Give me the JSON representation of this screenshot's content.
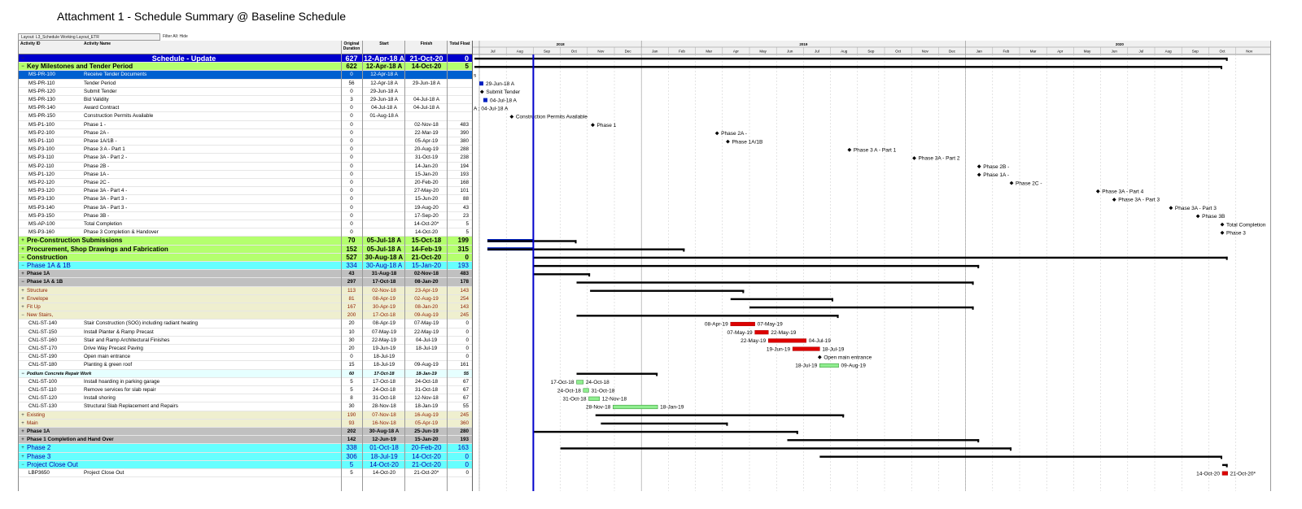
{
  "title": "Attachment 1 - Schedule Summary @ Baseline Schedule",
  "layout_label": "Layout: L3_Schedule Working Layout_ETR",
  "filter_label": "Filter All: Hide",
  "headers": {
    "id": "Activity ID",
    "name": "Activity Name",
    "dur": "Original Duration",
    "start": "Start",
    "finish": "Finish",
    "tf": "Total Float"
  },
  "timeline": {
    "years": [
      {
        "label": "2018",
        "from": 0,
        "to": 6
      },
      {
        "label": "2019",
        "from": 6,
        "to": 18
      },
      {
        "label": "2020",
        "from": 18,
        "to": 30
      }
    ],
    "months": [
      "Jul",
      "Aug",
      "Sep",
      "Oct",
      "Nov",
      "Dec",
      "Jan",
      "Feb",
      "Mar",
      "Apr",
      "May",
      "Jun",
      "Jul",
      "Aug",
      "Sep",
      "Oct",
      "Nov",
      "Dec",
      "Jan",
      "Feb",
      "Mar",
      "Apr",
      "May",
      "Jun",
      "Jul",
      "Aug",
      "Sep",
      "Oct",
      "Nov"
    ],
    "data_date_month": 2.0
  },
  "rows": [
    {
      "style": "grp-root",
      "exp": "−",
      "title": "Schedule - Update",
      "dur": "627",
      "start": "12-Apr-18 A",
      "finish": "21-Oct-20",
      "tf": "0",
      "bar": {
        "type": "summary",
        "s": -2,
        "e": 27.7
      }
    },
    {
      "style": "grp-green",
      "exp": "−",
      "title": "Key Milestones and Tender Period",
      "dur": "622",
      "start": "12-Apr-18 A",
      "finish": "14-Oct-20",
      "tf": "5",
      "bar": {
        "type": "summary",
        "s": -2,
        "e": 27.5
      }
    },
    {
      "style": "sel",
      "id": "MS-PR-100",
      "name": "Receive Tender Documents",
      "dur": "0",
      "start": "12-Apr-18 A",
      "finish": "",
      "tf": "",
      "bar": {
        "type": "text",
        "x": 0,
        "label": "s",
        "anchor": "start"
      }
    },
    {
      "style": "act",
      "id": "MS-PR-110",
      "name": "Tender Period",
      "dur": "56",
      "start": "12-Apr-18 A",
      "finish": "29-Jun-18 A",
      "tf": "",
      "bar": {
        "type": "done",
        "x": 0,
        "label": "29-Jun-18 A"
      }
    },
    {
      "style": "act",
      "id": "MS-PR-120",
      "name": "Submit Tender",
      "dur": "0",
      "start": "29-Jun-18 A",
      "finish": "",
      "tf": "",
      "bar": {
        "type": "ms",
        "x": 0.1,
        "label": "Submit Tender"
      }
    },
    {
      "style": "act",
      "id": "MS-PR-130",
      "name": "Bid Validity",
      "dur": "3",
      "start": "29-Jun-18 A",
      "finish": "04-Jul-18 A",
      "tf": "",
      "bar": {
        "type": "done",
        "x": 0.15,
        "label": "04-Jul-18 A"
      }
    },
    {
      "style": "act",
      "id": "MS-PR-140",
      "name": "Award Contract",
      "dur": "0",
      "start": "04-Jul-18 A",
      "finish": "04-Jul-18 A",
      "tf": "",
      "bar": {
        "type": "text",
        "x": 0,
        "label": "A  ;  04-Jul-18 A",
        "anchor": "start"
      }
    },
    {
      "style": "act",
      "id": "MS-PR-150",
      "name": "Construction Permits Available",
      "dur": "0",
      "start": "01-Aug-18 A",
      "finish": "",
      "tf": "",
      "bar": {
        "type": "ms",
        "x": 1.2,
        "label": "Construction Permits Available"
      }
    },
    {
      "style": "act",
      "id": "MS-P1-100",
      "name": "Phase 1 -",
      "dur": "0",
      "start": "",
      "finish": "02-Nov-18",
      "tf": "483",
      "bar": {
        "type": "ms",
        "x": 4.2,
        "label": "Phase 1"
      }
    },
    {
      "style": "act",
      "id": "MS-P2-100",
      "name": "Phase 2A -",
      "dur": "0",
      "start": "",
      "finish": "22-Mar-19",
      "tf": "390",
      "bar": {
        "type": "ms",
        "x": 8.8,
        "label": "Phase 2A -"
      }
    },
    {
      "style": "act",
      "id": "MS-P1-110",
      "name": "Phase 1A/1B -",
      "dur": "0",
      "start": "",
      "finish": "05-Apr-19",
      "tf": "380",
      "bar": {
        "type": "ms",
        "x": 9.2,
        "label": "Phase 1A/1B"
      }
    },
    {
      "style": "act",
      "id": "MS-P3-100",
      "name": "Phase 3 A - Part 1",
      "dur": "0",
      "start": "",
      "finish": "20-Aug-19",
      "tf": "288",
      "bar": {
        "type": "ms",
        "x": 13.7,
        "label": "Phase 3 A - Part 1"
      }
    },
    {
      "style": "act",
      "id": "MS-P3-110",
      "name": "Phase 3A - Part 2 -",
      "dur": "0",
      "start": "",
      "finish": "31-Oct-19",
      "tf": "238",
      "bar": {
        "type": "ms",
        "x": 16.1,
        "label": "Phase 3A - Part 2"
      }
    },
    {
      "style": "act",
      "id": "MS-P2-110",
      "name": "Phase 2B -",
      "dur": "0",
      "start": "",
      "finish": "14-Jan-20",
      "tf": "194",
      "bar": {
        "type": "ms",
        "x": 18.5,
        "label": "Phase 2B -"
      }
    },
    {
      "style": "act",
      "id": "MS-P1-120",
      "name": "Phase 1A -",
      "dur": "0",
      "start": "",
      "finish": "15-Jan-20",
      "tf": "193",
      "bar": {
        "type": "ms",
        "x": 18.5,
        "label": "Phase 1A -"
      }
    },
    {
      "style": "act",
      "id": "MS-P2-120",
      "name": "Phase 2C -",
      "dur": "0",
      "start": "",
      "finish": "20-Feb-20",
      "tf": "168",
      "bar": {
        "type": "ms",
        "x": 19.7,
        "label": "Phase 2C -"
      }
    },
    {
      "style": "act",
      "id": "MS-P3-120",
      "name": "Phase 3A - Part 4 -",
      "dur": "0",
      "start": "",
      "finish": "27-May-20",
      "tf": "101",
      "bar": {
        "type": "ms",
        "x": 22.9,
        "label": "Phase 3A - Part 4"
      }
    },
    {
      "style": "act",
      "id": "MS-P3-130",
      "name": "Phase 3A - Part 3 -",
      "dur": "0",
      "start": "",
      "finish": "15-Jun-20",
      "tf": "88",
      "bar": {
        "type": "ms",
        "x": 23.5,
        "label": "Phase 3A - Part 3"
      }
    },
    {
      "style": "act",
      "id": "MS-P3-140",
      "name": "Phase 3A - Part 3 -",
      "dur": "0",
      "start": "",
      "finish": "19-Aug-20",
      "tf": "43",
      "bar": {
        "type": "ms",
        "x": 25.6,
        "label": "Phase 3A - Part 3"
      }
    },
    {
      "style": "act",
      "id": "MS-P3-150",
      "name": "Phase 3B -",
      "dur": "0",
      "start": "",
      "finish": "17-Sep-20",
      "tf": "23",
      "bar": {
        "type": "ms",
        "x": 26.6,
        "label": "Phase 3B"
      }
    },
    {
      "style": "act",
      "id": "MS-AP-100",
      "name": "Total Completion",
      "dur": "0",
      "start": "",
      "finish": "14-Oct-20*",
      "tf": "5",
      "bar": {
        "type": "ms",
        "x": 27.5,
        "label": "Total Completion"
      }
    },
    {
      "style": "act",
      "id": "MS-P3-160",
      "name": "Phase 3 Completion & Handover",
      "dur": "0",
      "start": "",
      "finish": "14-Oct-20",
      "tf": "5",
      "bar": {
        "type": "ms",
        "x": 27.5,
        "label": "Phase 3"
      }
    },
    {
      "style": "grp-green",
      "exp": "+",
      "title": "Pre-Construction Submissions",
      "dur": "70",
      "start": "05-Jul-18 A",
      "finish": "15-Oct-18",
      "tf": "199",
      "bar": {
        "type": "summary",
        "s": 0.3,
        "e": 3.6,
        "blue": true
      }
    },
    {
      "style": "grp-green",
      "exp": "+",
      "title": "Procurement, Shop Drawings and Fabrication",
      "dur": "152",
      "start": "05-Jul-18 A",
      "finish": "14-Feb-19",
      "tf": "315",
      "bar": {
        "type": "summary",
        "s": 0.3,
        "e": 7.6,
        "blue": true
      }
    },
    {
      "style": "grp-green",
      "exp": "−",
      "title": "Construction",
      "dur": "527",
      "start": "30-Aug-18 A",
      "finish": "21-Oct-20",
      "tf": "0",
      "bar": {
        "type": "summary",
        "s": 2.0,
        "e": 27.7
      }
    },
    {
      "style": "grp-cyan",
      "exp": "−",
      "title": "Phase 1A & 1B",
      "dur": "334",
      "start": "30-Aug-18 A",
      "finish": "15-Jan-20",
      "tf": "193",
      "bar": {
        "type": "summary",
        "s": 2.0,
        "e": 18.5
      }
    },
    {
      "style": "grp-grey",
      "exp": "+",
      "title": "Phase 1A",
      "dur": "43",
      "start": "31-Aug-18",
      "finish": "02-Nov-18",
      "tf": "483",
      "bar": {
        "type": "summary",
        "s": 2.0,
        "e": 4.1
      }
    },
    {
      "style": "grp-grey",
      "exp": "−",
      "title": "Phase 1A & 1B",
      "dur": "297",
      "start": "17-Oct-18",
      "finish": "08-Jan-20",
      "tf": "178",
      "bar": {
        "type": "summary",
        "s": 3.6,
        "e": 18.3
      }
    },
    {
      "style": "grp-tan",
      "exp": "+",
      "title": "        Structure",
      "dur": "113",
      "start": "02-Nov-18",
      "finish": "23-Apr-19",
      "tf": "143",
      "bar": {
        "type": "summary",
        "s": 4.1,
        "e": 9.8
      }
    },
    {
      "style": "grp-tan",
      "exp": "+",
      "title": "        Envelope",
      "dur": "81",
      "start": "08-Apr-19",
      "finish": "02-Aug-19",
      "tf": "254",
      "bar": {
        "type": "summary",
        "s": 9.3,
        "e": 13.1
      }
    },
    {
      "style": "grp-tan",
      "exp": "+",
      "title": "        Fit Up",
      "dur": "167",
      "start": "30-Apr-19",
      "finish": "08-Jan-20",
      "tf": "143",
      "bar": {
        "type": "summary",
        "s": 10.0,
        "e": 18.3
      }
    },
    {
      "style": "grp-tan",
      "exp": "−",
      "title": "New Stairs,",
      "dur": "200",
      "start": "17-Oct-18",
      "finish": "09-Aug-19",
      "tf": "245",
      "bar": {
        "type": "summary",
        "s": 3.6,
        "e": 13.3
      }
    },
    {
      "style": "act",
      "id": "CN1-ST-140",
      "name": "Stair Construction (SOG) including radiant heating",
      "dur": "20",
      "start": "08-Apr-19",
      "finish": "07-May-19",
      "tf": "0",
      "bar": {
        "type": "crit",
        "s": 9.3,
        "e": 10.2,
        "ls": "08-Apr-19",
        "le": "07-May-19"
      }
    },
    {
      "style": "act",
      "id": "CN1-ST-150",
      "name": "Install Planter & Ramp Precast",
      "dur": "10",
      "start": "07-May-19",
      "finish": "22-May-19",
      "tf": "0",
      "bar": {
        "type": "crit",
        "s": 10.2,
        "e": 10.7,
        "ls": "07-May-19",
        "le": "22-May-19"
      }
    },
    {
      "style": "act",
      "id": "CN1-ST-160",
      "name": "Stair and Ramp Architectural Finishes",
      "dur": "30",
      "start": "22-May-19",
      "finish": "04-Jul-19",
      "tf": "0",
      "bar": {
        "type": "crit",
        "s": 10.7,
        "e": 12.1,
        "ls": "22-May-19",
        "le": "04-Jul-19"
      }
    },
    {
      "style": "act",
      "id": "CN1-ST-170",
      "name": "Drive Way Precast Paving",
      "dur": "20",
      "start": "19-Jun-19",
      "finish": "18-Jul-19",
      "tf": "0",
      "bar": {
        "type": "crit",
        "s": 11.6,
        "e": 12.6,
        "ls": "19-Jun-19",
        "le": "18-Jul-19"
      }
    },
    {
      "style": "act",
      "id": "CN1-ST-190",
      "name": "Open main entrance",
      "dur": "0",
      "start": "18-Jul-19",
      "finish": "",
      "tf": "0",
      "bar": {
        "type": "ms",
        "x": 12.6,
        "label": "Open main entrance"
      }
    },
    {
      "style": "act",
      "id": "CN1-ST-180",
      "name": "Planting & green roof",
      "dur": "15",
      "start": "18-Jul-19",
      "finish": "09-Aug-19",
      "tf": "161",
      "bar": {
        "type": "nc",
        "s": 12.6,
        "e": 13.3,
        "ls": "18-Jul-19",
        "le": "09-Aug-19"
      }
    },
    {
      "style": "grp-ltcyan",
      "exp": "−",
      "title": "Podium Concrete Repair Work",
      "dur": "60",
      "start": "17-Oct-18",
      "finish": "18-Jan-19",
      "tf": "55",
      "bar": {
        "type": "summary",
        "s": 3.6,
        "e": 6.6
      }
    },
    {
      "style": "act",
      "id": "CN1-ST-100",
      "name": "Install hoarding in parking garage",
      "dur": "5",
      "start": "17-Oct-18",
      "finish": "24-Oct-18",
      "tf": "67",
      "bar": {
        "type": "nc",
        "s": 3.6,
        "e": 3.85,
        "ls": "17-Oct-18",
        "le": "24-Oct-18"
      }
    },
    {
      "style": "act",
      "id": "CN1-ST-110",
      "name": "Remove services for slab repair",
      "dur": "5",
      "start": "24-Oct-18",
      "finish": "31-Oct-18",
      "tf": "67",
      "bar": {
        "type": "nc",
        "s": 3.85,
        "e": 4.05,
        "ls": "24-Oct-18",
        "le": "31-Oct-18"
      }
    },
    {
      "style": "act",
      "id": "CN1-ST-120",
      "name": "Install shoring",
      "dur": "8",
      "start": "31-Oct-18",
      "finish": "12-Nov-18",
      "tf": "67",
      "bar": {
        "type": "nc",
        "s": 4.05,
        "e": 4.45,
        "ls": "31-Oct-18",
        "le": "12-Nov-18"
      }
    },
    {
      "style": "act",
      "id": "CN1-ST-130",
      "name": "Structural Slab Replacement and Repairs",
      "dur": "30",
      "start": "28-Nov-18",
      "finish": "18-Jan-19",
      "tf": "55",
      "bar": {
        "type": "nc",
        "s": 4.95,
        "e": 6.6,
        "ls": "28-Nov-18",
        "le": "18-Jan-19"
      }
    },
    {
      "style": "grp-tan",
      "exp": "+",
      "title": "Existing",
      "dur": "190",
      "start": "07-Nov-18",
      "finish": "16-Aug-19",
      "tf": "245",
      "bar": {
        "type": "summary",
        "s": 4.3,
        "e": 13.5
      }
    },
    {
      "style": "grp-tan",
      "exp": "+",
      "title": "Main",
      "dur": "93",
      "start": "16-Nov-18",
      "finish": "05-Apr-19",
      "tf": "360",
      "bar": {
        "type": "summary",
        "s": 4.5,
        "e": 9.2
      }
    },
    {
      "style": "grp-grey",
      "exp": "+",
      "title": "Phase 1A",
      "dur": "202",
      "start": "30-Aug-18 A",
      "finish": "25-Jun-19",
      "tf": "280",
      "bar": {
        "type": "summary",
        "s": 2.0,
        "e": 11.8
      }
    },
    {
      "style": "grp-grey",
      "exp": "+",
      "title": "Phase 1 Completion and Hand Over",
      "dur": "142",
      "start": "12-Jun-19",
      "finish": "15-Jan-20",
      "tf": "193",
      "bar": {
        "type": "summary",
        "s": 11.4,
        "e": 18.5
      }
    },
    {
      "style": "grp-cyan",
      "exp": "+",
      "title": "Phase 2",
      "dur": "338",
      "start": "01-Oct-18",
      "finish": "20-Feb-20",
      "tf": "163",
      "bar": {
        "type": "summary",
        "s": 3.0,
        "e": 19.7
      }
    },
    {
      "style": "grp-cyan",
      "exp": "+",
      "title": "Phase 3",
      "dur": "306",
      "start": "18-Jul-19",
      "finish": "14-Oct-20",
      "tf": "0",
      "bar": {
        "type": "summary",
        "s": 12.6,
        "e": 27.5
      }
    },
    {
      "style": "grp-cyan",
      "exp": "−",
      "title": "Project Close Out",
      "dur": "5",
      "start": "14-Oct-20",
      "finish": "21-Oct-20",
      "tf": "0",
      "bar": {
        "type": "summary",
        "s": 27.5,
        "e": 27.7
      }
    },
    {
      "style": "act",
      "id": "LBP3650",
      "name": "Project Close Out",
      "dur": "5",
      "start": "14-Oct-20",
      "finish": "21-Oct-20*",
      "tf": "0",
      "bar": {
        "type": "crit",
        "s": 27.5,
        "e": 27.7,
        "ls": "14-Oct-20",
        "le": "21-Oct-20*"
      }
    }
  ]
}
